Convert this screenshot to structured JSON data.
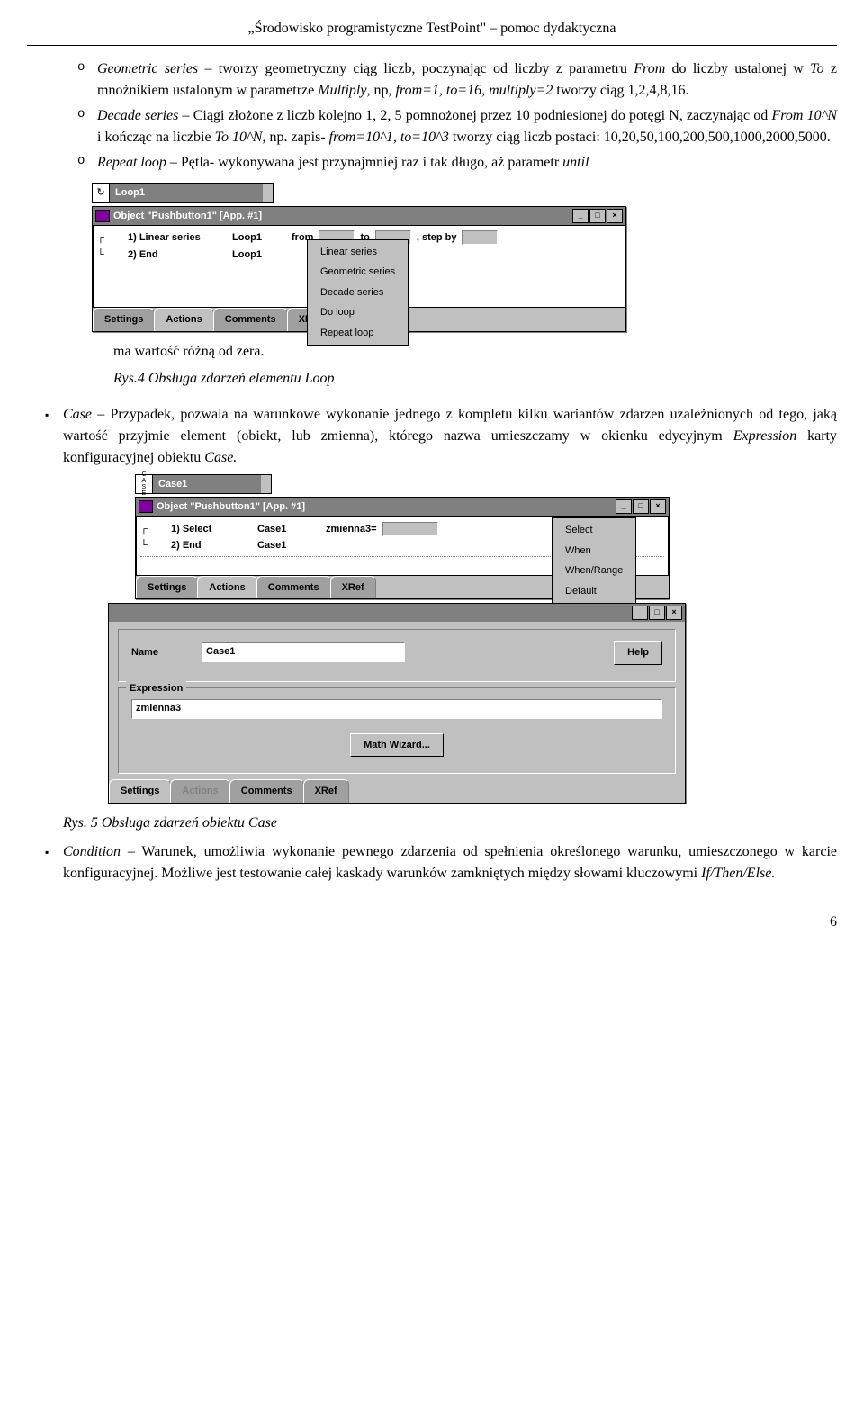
{
  "header": "„Środowisko programistyczne TestPoint\" – pomoc dydaktyczna",
  "bullets": {
    "geo": "Geometric series – tworzy geometryczny ciąg liczb, poczynając od liczby z parametru From do liczby ustalonej w To z mnożnikiem ustalonym w parametrze Multiply, np, from=1, to=16, multiply=2 tworzy ciąg 1,2,4,8,16.",
    "dec": "Decade series – Ciągi złożone z liczb kolejno 1, 2, 5 pomnożonej przez 10 podniesionej do potęgi N, zaczynając od From 10^N i kończąc na liczbie To 10^N, np. zapis- from=10^1, to=10^3 tworzy ciąg liczb postaci: 10,20,50,100,200,500,1000,2000,5000.",
    "rep": "Repeat loop – Pętla- wykonywana jest przynajmniej raz i tak długo, aż parametr until",
    "rep_tail": "ma wartość różną od zera.",
    "case": "Case – Przypadek, pozwala na warunkowe wykonanie jednego z kompletu kilku wariantów zdarzeń uzależnionych od tego, jaką wartość przyjmie element (obiekt, lub zmienna), którego nazwa umieszczamy w okienku edycyjnym Expression karty konfiguracyjnej obiektu Case.",
    "cond": "Condition – Warunek, umożliwia wykonanie pewnego zdarzenia od spełnienia określonego warunku, umieszczonego w karcie konfiguracyjnej. Możliwe jest testowanie całej kaskady warunków zamkniętych między słowami kluczowymi If/Then/Else."
  },
  "captions": {
    "fig4": "Rys.4 Obsługa zdarzeń elementu Loop",
    "fig5": "Rys. 5 Obsługa zdarzeń obiektu Case"
  },
  "loop_window": {
    "bar_label": "Loop1",
    "title": "Object \"Pushbutton1\" [App. #1]",
    "rows": {
      "r1_a": "1) Linear series",
      "r1_b": "Loop1",
      "r1_c": "from",
      "r1_d": "to",
      "r1_e": ", step by",
      "r2_a": "2) End",
      "r2_b": "Loop1"
    },
    "tabs": {
      "t1": "Settings",
      "t2": "Actions",
      "t3": "Comments",
      "t4": "XRef"
    },
    "menu": {
      "m1": "Linear series",
      "m2": "Geometric series",
      "m3": "Decade series",
      "m4": "Do loop",
      "m5": "Repeat loop"
    }
  },
  "case_window": {
    "bar_label": "Case1",
    "title": "Object \"Pushbutton1\" [App. #1]",
    "rows": {
      "r1_a": "1) Select",
      "r1_b": "Case1",
      "r1_c": "zmienna3=",
      "r2_a": "2) End",
      "r2_b": "Case1"
    },
    "tabs": {
      "t1": "Settings",
      "t2": "Actions",
      "t3": "Comments",
      "t4": "XRef"
    },
    "menu": {
      "m1": "Select",
      "m2": "When",
      "m3": "When/Range",
      "m4": "Default"
    },
    "settings": {
      "name_label": "Name",
      "name_value": "Case1",
      "help": "Help",
      "expr_label": "Expression",
      "expr_value": "zmienna3",
      "wizard": "Math Wizard..."
    }
  },
  "page_number": "6"
}
